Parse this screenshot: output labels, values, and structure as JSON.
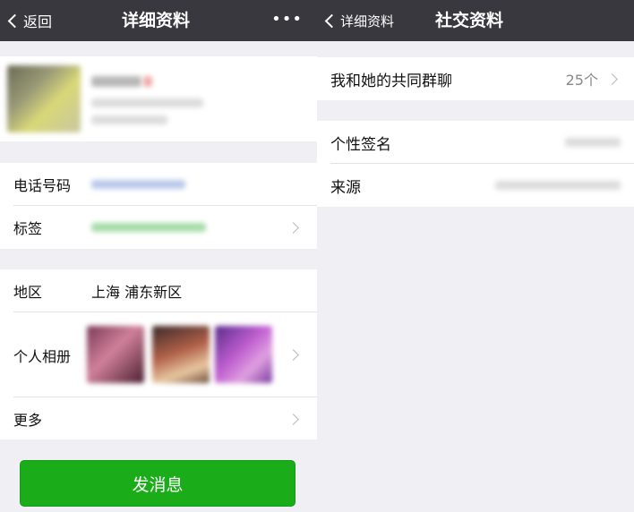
{
  "detail_screen": {
    "nav": {
      "back_label": "返回",
      "title": "详细资料",
      "more_label": "•••"
    },
    "profile": {
      "avatar_icon": "avatar",
      "name_redacted": true
    },
    "contact": [
      {
        "label": "电话号码",
        "value_redacted": true
      },
      {
        "label": "标签",
        "value_redacted": true,
        "value_color": "#9bd79b"
      }
    ],
    "info": {
      "region_label": "地区",
      "region_value": "上海 浦东新区",
      "album_label": "个人相册",
      "more_label": "更多"
    },
    "send_button_label": "发消息",
    "colors": {
      "nav_bg": "#39383e",
      "accent": "#1aad19",
      "page_bg": "#efeff4"
    }
  },
  "social_screen": {
    "nav": {
      "back_label": "详细资料",
      "title": "社交资料"
    },
    "groups_row": {
      "label": "我和她的共同群聊",
      "value": "25个"
    },
    "signature_label": "个性签名",
    "source_label": "来源"
  }
}
